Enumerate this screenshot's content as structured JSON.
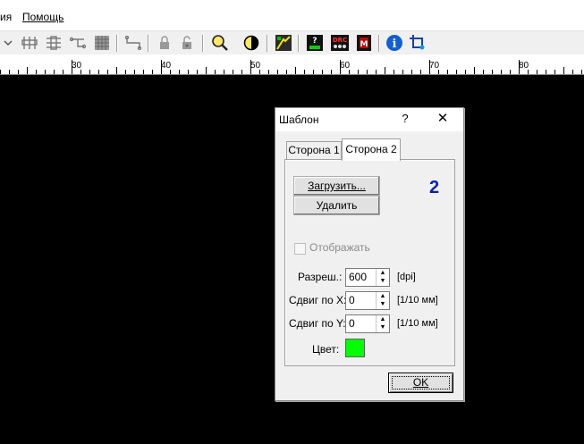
{
  "menu": {
    "item_partial": "ия",
    "help": "Помощь"
  },
  "toolbar": {
    "icons": [
      "chevron-down-icon",
      "align-icon",
      "distribute-icon",
      "network-icon",
      "grid-icon",
      "route-icon",
      "lock-icon",
      "unlock-icon",
      "zoom-icon",
      "contrast-icon",
      "autoroute-icon",
      "macro-icon",
      "drc-icon",
      "m-icon",
      "info-icon",
      "crosshair-icon"
    ],
    "drc_label": "DRC",
    "m_label": "M",
    "info_label": "i"
  },
  "ruler": {
    "labels": [
      "30",
      "40",
      "50",
      "60",
      "70",
      "80"
    ]
  },
  "dialog": {
    "title": "Шаблон",
    "help": "?",
    "close": "✕",
    "tabs": [
      "Сторона 1",
      "Сторона 2"
    ],
    "active_tab": "Сторона 2",
    "load_button": "Загрузить...",
    "delete_button": "Удалить",
    "side_number": "2",
    "show_checkbox_label": "Отображать",
    "show_checkbox_checked": false,
    "resolution_label": "Разреш.:",
    "resolution_value": "600",
    "resolution_unit": "[dpi]",
    "shift_x_label": "Сдвиг по X:",
    "shift_x_value": "0",
    "shift_x_unit": "[1/10 мм]",
    "shift_y_label": "Сдвиг по Y:",
    "shift_y_value": "0",
    "shift_y_unit": "[1/10 мм]",
    "color_label": "Цвет:",
    "color_value": "#00ff00",
    "ok_button": "OK"
  }
}
